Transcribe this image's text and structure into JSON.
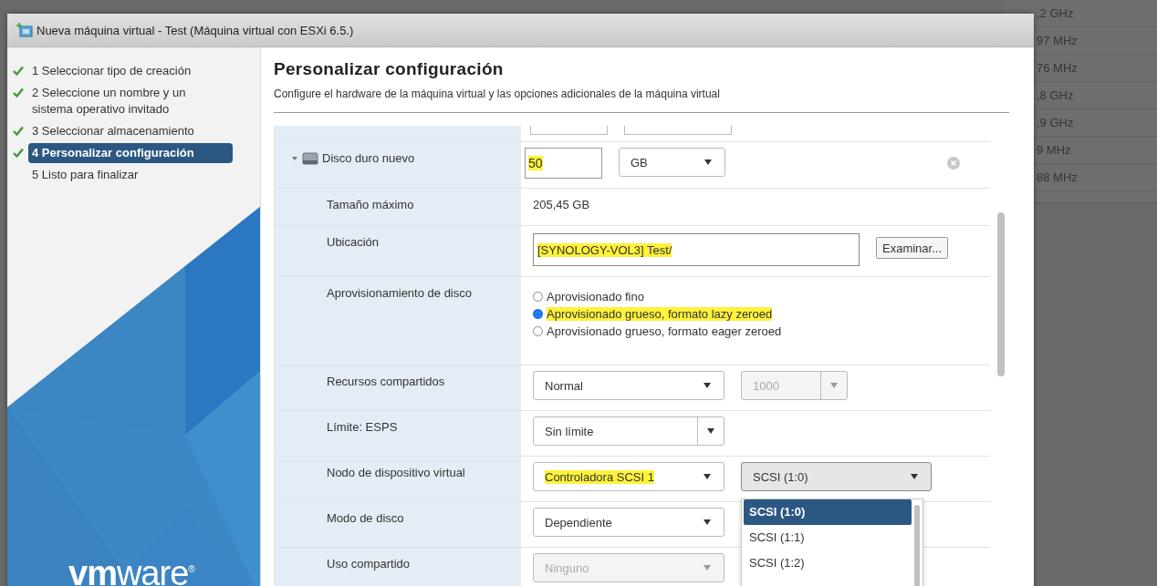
{
  "background_table": {
    "rows": [
      ",2 GHz",
      "97 MHz",
      "76 MHz",
      ",8 GHz",
      ",9 GHz",
      "9 MHz",
      "88 MHz"
    ]
  },
  "window": {
    "title": "Nueva máquina virtual - Test (Máquina virtual con ESXi 6.5.)"
  },
  "steps": [
    {
      "label": "1 Seleccionar tipo de creación",
      "done": true,
      "selected": false
    },
    {
      "label": "2 Seleccione un nombre y un sistema operativo invitado",
      "done": true,
      "selected": false
    },
    {
      "label": "3 Seleccionar almacenamiento",
      "done": true,
      "selected": false
    },
    {
      "label": "4 Personalizar configuración",
      "done": true,
      "selected": true
    },
    {
      "label": "5 Listo para finalizar",
      "done": false,
      "selected": false
    }
  ],
  "logo": "**vm**ware$^{®}$",
  "page": {
    "title": "Personalizar configuración",
    "subtitle": "Configure el hardware de la máquina virtual y las opciones adicionales de la máquina virtual"
  },
  "rows": [
    {
      "kind": "header",
      "label": "Disco duro nuevo",
      "expanded": true,
      "size": {
        "value": "50",
        "highlighted": true
      },
      "unit": {
        "value": "GB"
      }
    },
    {
      "kind": "text",
      "label": "Tamaño máximo",
      "value": "205,45 GB"
    },
    {
      "kind": "path",
      "label": "Ubicación",
      "value": "[SYNOLOGY-VOL3] Test/",
      "highlighted": true,
      "button": "Examinar..."
    },
    {
      "kind": "radio",
      "label": "Aprovisionamiento de disco",
      "options": [
        {
          "label": "Aprovisionado fino",
          "selected": false,
          "highlighted": false
        },
        {
          "label": "Aprovisionado grueso, formato lazy zeroed",
          "selected": true,
          "highlighted": true
        },
        {
          "label": "Aprovisionado grueso, formato eager zeroed",
          "selected": false,
          "highlighted": false
        }
      ]
    },
    {
      "kind": "select",
      "label": "Recursos compartidos",
      "selects": [
        {
          "value": "Normal",
          "disabled": false,
          "split": false,
          "highlighted": false,
          "expanded": false
        },
        {
          "value": "1000",
          "disabled": true,
          "split": true,
          "highlighted": false,
          "expanded": false
        }
      ]
    },
    {
      "kind": "select",
      "label": "Límite: ESPS",
      "selects": [
        {
          "value": "Sin límite",
          "disabled": false,
          "split": true,
          "highlighted": false,
          "expanded": false
        }
      ]
    },
    {
      "kind": "select",
      "label": "Nodo de dispositivo virtual",
      "selects": [
        {
          "value": "Controladora SCSI 1",
          "disabled": false,
          "split": false,
          "highlighted": true,
          "expanded": false
        },
        {
          "value": "SCSI (1:0)",
          "disabled": false,
          "split": false,
          "highlighted": false,
          "expanded": true,
          "options": [
            {
              "label": "SCSI (1:0)",
              "selected": true
            },
            {
              "label": "SCSI (1:1)",
              "selected": false
            },
            {
              "label": "SCSI (1:2)",
              "selected": false
            }
          ]
        }
      ]
    },
    {
      "kind": "select",
      "label": "Modo de disco",
      "selects": [
        {
          "value": "Dependiente",
          "disabled": false,
          "split": false,
          "highlighted": false,
          "expanded": false
        }
      ]
    },
    {
      "kind": "select",
      "label": "Uso compartido",
      "selects": [
        {
          "value": "Ninguno",
          "disabled": true,
          "split": false,
          "highlighted": false,
          "expanded": false
        }
      ]
    }
  ]
}
